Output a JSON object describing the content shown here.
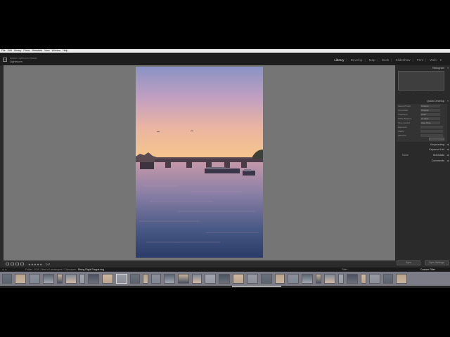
{
  "menubar": [
    "File",
    "Edit",
    "Library",
    "Photo",
    "Metadata",
    "View",
    "Window",
    "Help"
  ],
  "identity": {
    "line1": "Adobe Lightroom Classic",
    "line2": "Lightroom"
  },
  "modules": [
    "Library",
    "Develop",
    "Map",
    "Book",
    "Slideshow",
    "Print",
    "Web"
  ],
  "active_module": "Library",
  "panels": {
    "histogram": "Histogram",
    "quick_develop": "Quick Develop",
    "saved_preset_label": "Saved Preset",
    "saved_preset_value": "Custom",
    "crop_label": "Crop Ratio",
    "crop_value": "Original",
    "treatment_label": "Treatment",
    "treatment_value": "Color",
    "wb_label": "White Balance",
    "wb_value": "As Shot",
    "tone_label": "Tone Control",
    "tone_value": "Auto Tone",
    "exposure_label": "Exposure",
    "clarity_label": "Clarity",
    "vibrance_label": "Vibrance",
    "keywording": "Keywording",
    "keyword_list": "Keyword List",
    "metadata": "Metadata",
    "comments": "Comments",
    "metadata_preset": "None",
    "sync_button": "Sync",
    "sync_settings_button": "Sync Settings"
  },
  "filmstrip": {
    "breadcrumb_prefix": "Folder : 2019",
    "breadcrumb_path": "Best of Landscapes / Cityscapes",
    "selected_file": "Rising Flight Prague.dng",
    "filter_label": "Filter :",
    "filter_value": "Custom Filter",
    "nav_icons": "◂ ▸"
  },
  "toolbar": {
    "stars": "★★★★★"
  }
}
